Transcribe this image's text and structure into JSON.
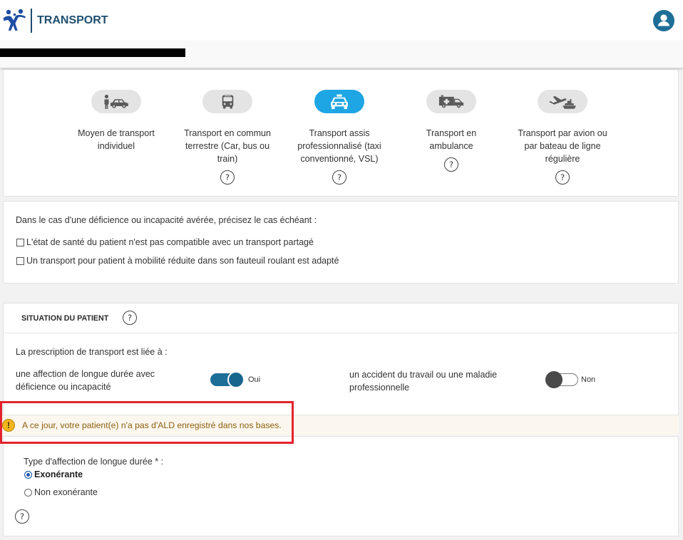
{
  "header": {
    "title": "TRANSPORT",
    "logo_icon": "assurance-maladie-logo-icon",
    "account_icon": "user-account-icon"
  },
  "colors": {
    "page_bg": "#f2f2f2",
    "text": "#333333",
    "brand": "#1f4e6f",
    "mode_pill": "#e4e4e4",
    "selected_mode": "#1ea6e4",
    "toggle_on": "#1d6f97",
    "toggle_on_knob": "#17668e",
    "toggle_off_knob": "#4a4a4a",
    "warning_icon": "#f2b51d",
    "warning_text": "#8d5e10",
    "highlight_red": "#e3232c"
  },
  "help_glyph": "?",
  "transport_modes": [
    {
      "label": "Moyen de transport\nindividuel",
      "icon": "car-with-person-icon",
      "selected": false,
      "has_help": false
    },
    {
      "label": "Transport en commun\nterrestre (Car, bus ou\ntrain)",
      "icon": "bus-icon",
      "selected": false,
      "has_help": true
    },
    {
      "label": "Transport assis\nprofessionnalisé (taxi\nconventionné, VSL)",
      "icon": "taxi-icon",
      "selected": true,
      "has_help": true
    },
    {
      "label": "Transport en\nambulance",
      "icon": "ambulance-icon",
      "selected": false,
      "has_help": true
    },
    {
      "label": "Transport par avion ou\npar bateau de ligne\nrégulière",
      "icon": "plane-and-boat-icon",
      "selected": false,
      "has_help": true
    }
  ],
  "deficiency": {
    "intro": "Dans le cas d'une déficience ou incapacité avérée, précisez le cas échéant :",
    "options": [
      {
        "label": "L'état de santé du patient n'est pas compatible avec un transport partagé",
        "checked": false
      },
      {
        "label": "Un transport pour patient à mobilité réduite dans son fauteuil roulant est adapté",
        "checked": false
      }
    ]
  },
  "patient_situation": {
    "title": "SITUATION DU PATIENT",
    "question": "La prescription de transport est liée à :",
    "ald": {
      "label": "une affection de longue durée avec\ndéficience ou incapacité",
      "on": true,
      "state_label": "Oui"
    },
    "work_accident": {
      "label": "un accident du travail ou une maladie\nprofessionnelle",
      "on": false,
      "state_label": "Non"
    }
  },
  "alert": {
    "icon": "warning-icon",
    "icon_glyph": "!",
    "message": "A ce jour, votre patient(e) n'a pas d'ALD enregistré dans nos bases.",
    "highlighted": true
  },
  "ald_type": {
    "label": "Type d'affection de longue durée * :",
    "options": [
      {
        "label": "Exonérante",
        "selected": true
      },
      {
        "label": "Non exonérante",
        "selected": false
      }
    ]
  }
}
